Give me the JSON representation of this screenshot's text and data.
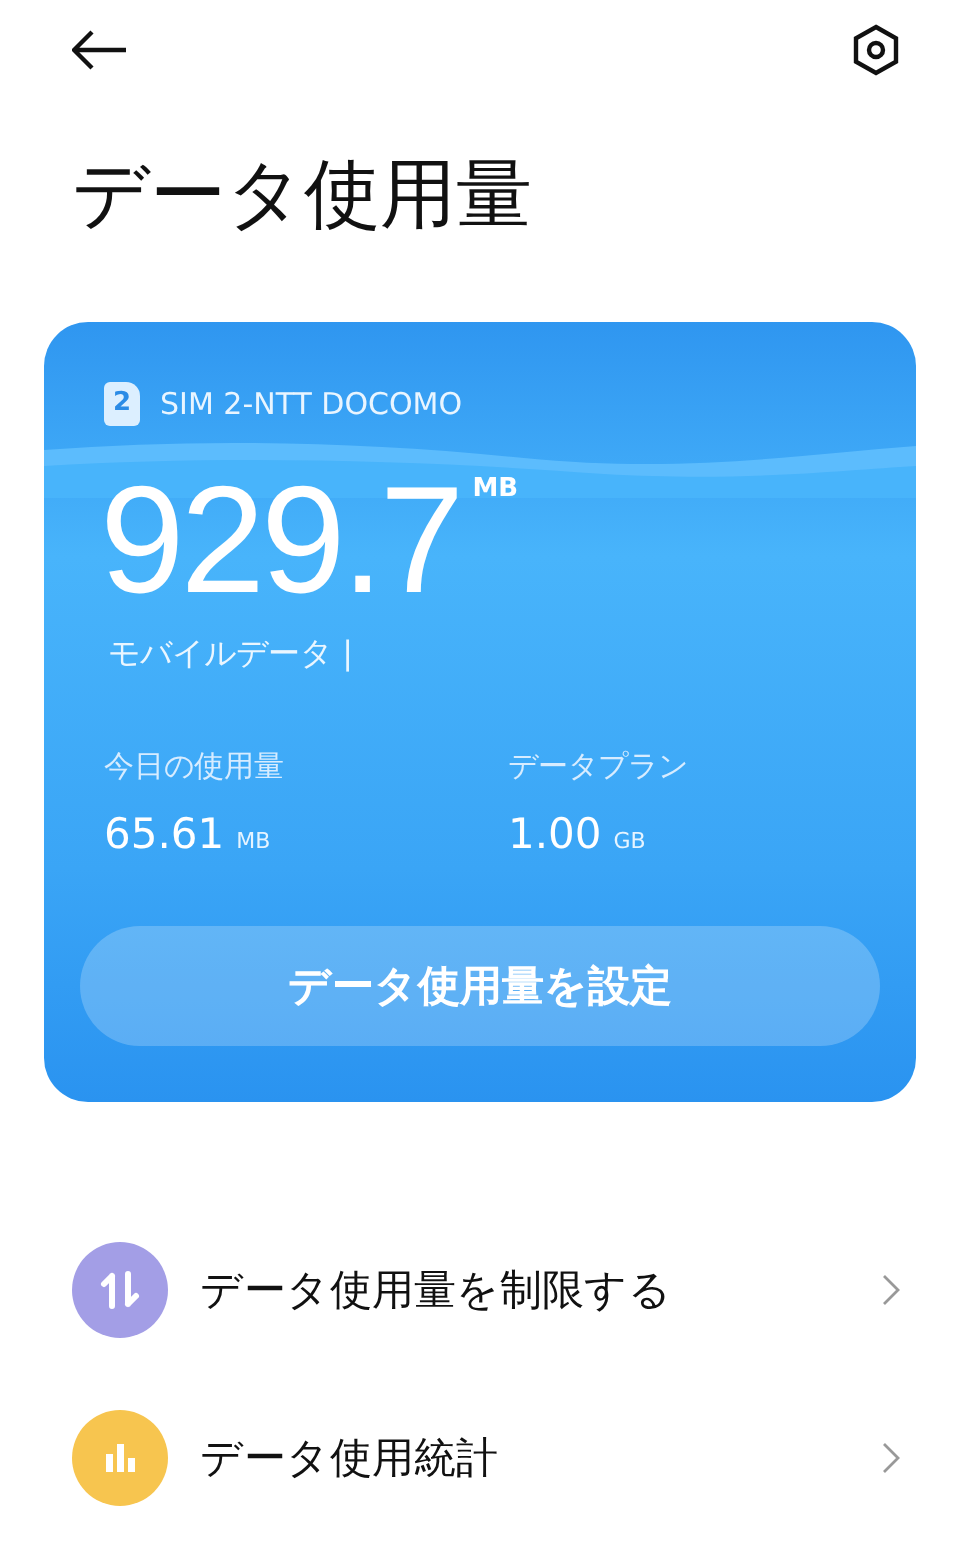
{
  "title": "データ使用量",
  "card": {
    "sim_badge": "2",
    "carrier": "SIM 2-NTT DOCOMO",
    "usage": "929.7",
    "usage_unit": "MB",
    "source": "モバイルデータ |",
    "stats": [
      {
        "label": "今日の使用量",
        "value": "65.61",
        "unit": "MB"
      },
      {
        "label": "データプラン",
        "value": "1.00",
        "unit": "GB"
      }
    ],
    "button": "データ使用量を設定"
  },
  "menu": [
    {
      "kind": "transfer",
      "color": "#a39ee6",
      "label": "データ使用量を制限する"
    },
    {
      "kind": "stats",
      "color": "#f7c54f",
      "label": "データ使用統計"
    }
  ]
}
